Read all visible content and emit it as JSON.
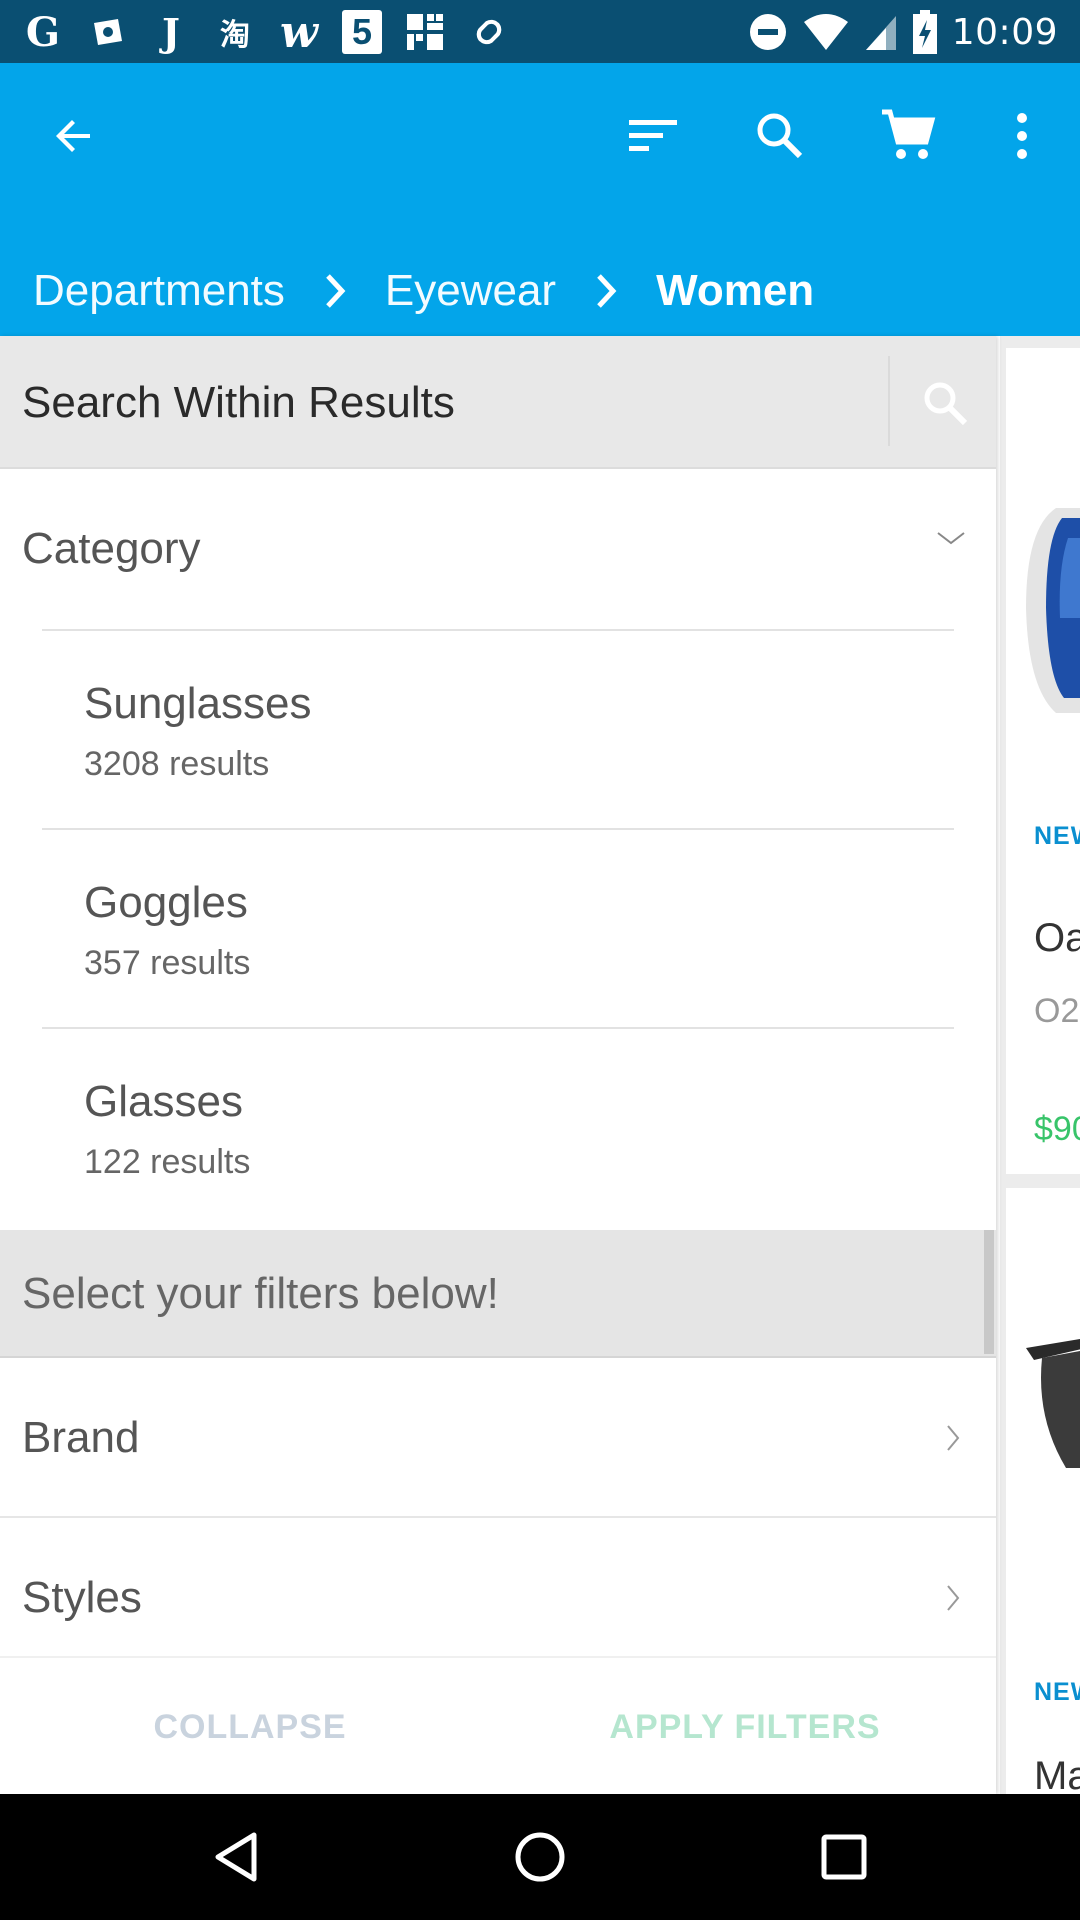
{
  "status_bar": {
    "time": "10:09",
    "left_icons": [
      "google-icon",
      "photos-icon",
      "j-app-icon",
      "taobao-icon",
      "w-app-icon",
      "five-app-icon",
      "grid-app-icon",
      "link-app-icon"
    ],
    "right_icons": [
      "do-not-disturb-icon",
      "wifi-icon",
      "cell-signal-icon",
      "battery-icon"
    ],
    "left_glyphs": [
      "G",
      "",
      "J",
      "淘",
      "w",
      "5",
      "",
      ""
    ]
  },
  "app_bar": {
    "color": "#03a5ea",
    "breadcrumb": [
      "Departments",
      "Eyewear",
      "Women"
    ]
  },
  "search": {
    "placeholder": "Search Within Results"
  },
  "category": {
    "label": "Category",
    "items": [
      {
        "name": "Sunglasses",
        "count": "3208 results"
      },
      {
        "name": "Goggles",
        "count": "357 results"
      },
      {
        "name": "Glasses",
        "count": "122 results"
      }
    ]
  },
  "filters_hint": "Select your filters below!",
  "facets": [
    "Brand",
    "Styles"
  ],
  "actions": {
    "collapse": "COLLAPSE",
    "apply": "APPLY FILTERS",
    "collapse_color": "#c9d3de",
    "apply_color": "#b5e6cf"
  },
  "products": [
    {
      "badge": "NEW",
      "title": "Oa",
      "subtitle": "O2",
      "price": "$90"
    },
    {
      "badge": "NEW",
      "title": "Ma"
    }
  ]
}
